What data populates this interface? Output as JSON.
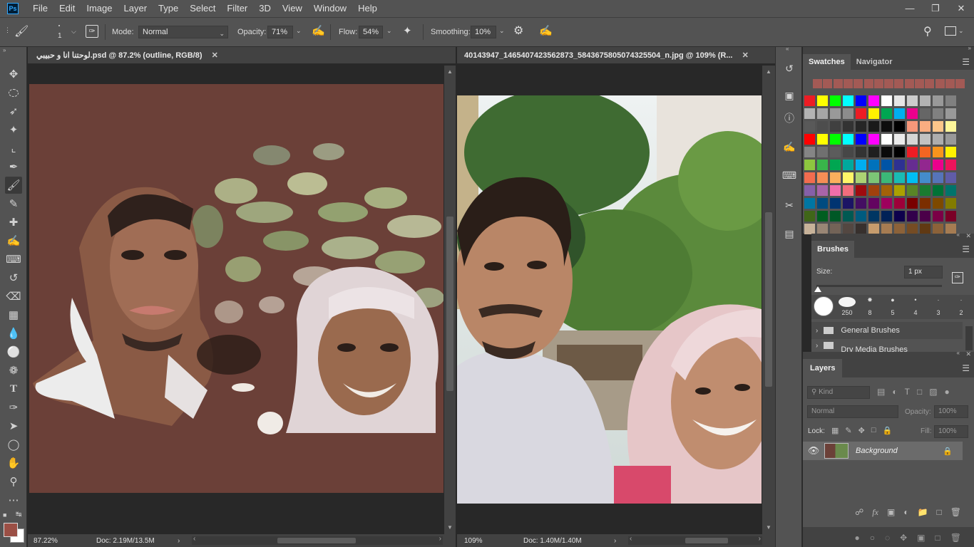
{
  "menu": {
    "app_icon": "Ps",
    "items": [
      "File",
      "Edit",
      "Image",
      "Layer",
      "Type",
      "Select",
      "Filter",
      "3D",
      "View",
      "Window",
      "Help"
    ],
    "window_controls": [
      "minimize-icon",
      "restore-icon",
      "close-icon"
    ]
  },
  "options": {
    "brush_size": "1",
    "mode_label": "Mode:",
    "mode_value": "Normal",
    "opacity_label": "Opacity:",
    "opacity_value": "71%",
    "flow_label": "Flow:",
    "flow_value": "54%",
    "smoothing_label": "Smoothing:",
    "smoothing_value": "10%"
  },
  "toolbar": {
    "tools": [
      "move-tool",
      "marquee-tool",
      "lasso-tool",
      "magic-wand-tool",
      "crop-tool",
      "eyedropper-tool",
      "brush-tool",
      "pencil-tool",
      "healing-tool",
      "clone-stamp-tool",
      "history-brush-tool",
      "eraser-tool",
      "paint-bucket-tool",
      "blur-tool",
      "dodge-tool",
      "sponge-tool",
      "type-tool",
      "pen-tool",
      "path-selection-tool",
      "ellipse-tool",
      "hand-tool",
      "zoom-tool",
      "more-tools"
    ],
    "foreground_color": "#9b4f45",
    "background_color": "#ffffff"
  },
  "doc1": {
    "tab_title": "لوحتنا انا و حبيبي.psd @ 87.2% (outline, RGB/8)",
    "zoom": "87.22%",
    "doc_size": "Doc: 2.19M/13.5M",
    "canvas_color": "#6b4038"
  },
  "doc2": {
    "tab_title": "40143947_1465407423562873_5843675805074325504_n.jpg @ 109% (R...",
    "zoom": "109%",
    "doc_size": "Doc: 1.40M/1.40M"
  },
  "swatches": {
    "tab_active": "Swatches",
    "tab_inactive": "Navigator",
    "recent": [
      "#a35a55",
      "#a35a55",
      "#a35a55",
      "#a35a55",
      "#a35a55",
      "#a35a55",
      "#a35a55",
      "#a35a55",
      "#a35a55",
      "#a35a55",
      "#a35a55",
      "#a35a55",
      "#a35a55",
      "#a35a55",
      "#a35a55"
    ],
    "grid": [
      [
        "#ff0000",
        "#ffff00",
        "#00ff00",
        "#00ffff",
        "#0000ff",
        "#ff00ff",
        "#ffffff",
        "#ebebeb",
        "#d6d6d6",
        "#c2c2c2",
        "#adadad",
        "#999999"
      ],
      [
        "#858585",
        "#707070",
        "#5c5c5c",
        "#474747",
        "#333333",
        "#1f1f1f",
        "#0a0a0a",
        "#000000",
        "#ed1c24",
        "#f26522",
        "#f7941d",
        "#fff200"
      ],
      [
        "#8dc63f",
        "#39b54a",
        "#00a651",
        "#00a99d",
        "#00aeef",
        "#0072bc",
        "#0054a6",
        "#2e3192",
        "#662d91",
        "#92278f",
        "#ec008c",
        "#ed145b"
      ],
      [
        "#f26c4f",
        "#f68e56",
        "#fbaf5d",
        "#fff568",
        "#acd373",
        "#7cc576",
        "#3bb878",
        "#1abbb4",
        "#00bff3",
        "#448ccb",
        "#5674b9",
        "#605ca8"
      ],
      [
        "#8560a8",
        "#a864a8",
        "#f06eaa",
        "#f26d7d",
        "#9e0b0f",
        "#a0410d",
        "#a36209",
        "#aba000",
        "#598527",
        "#1a7b30",
        "#007236",
        "#00746b"
      ],
      [
        "#0076a3",
        "#004b80",
        "#003471",
        "#1b1464",
        "#440e62",
        "#630460",
        "#9e005d",
        "#9e0039",
        "#790000",
        "#7b2e00",
        "#7d4900",
        "#827b00"
      ],
      [
        "#406618",
        "#005e20",
        "#005826",
        "#005952",
        "#005b7f",
        "#003663",
        "#002157",
        "#0d004c",
        "#32004b",
        "#4b0049",
        "#7b0046",
        "#7a0026"
      ],
      [
        "#c7b299",
        "#998675",
        "#736357",
        "#534741",
        "#37302d",
        "#c69c6d",
        "#a67c52",
        "#8c6239",
        "#754c24",
        "#603913",
        "#8c6239",
        "#a67c52"
      ]
    ],
    "grid_top_rows": [
      [
        "#ed1c24",
        "#ffff00",
        "#00ff00",
        "#00ffff",
        "#0000ff",
        "#ff00ff",
        "#ffffff",
        "#e6e6e6",
        "#cccccc",
        "#b3b3b3",
        "#999999",
        "#808080"
      ],
      [
        "#b3b3b3",
        "#a6a6a6",
        "#999999",
        "#8c8c8c",
        "#ed1c24",
        "#fff200",
        "#00a651",
        "#00aeef",
        "#ec008c",
        "#666666",
        "#808080",
        "#999999"
      ],
      [
        "#595959",
        "#4d4d4d",
        "#404040",
        "#333333",
        "#262626",
        "#1a1a1a",
        "#0d0d0d",
        "#000000",
        "#f7977a",
        "#f9ad81",
        "#fdc68a",
        "#fff79a"
      ]
    ]
  },
  "brushes": {
    "title": "Brushes",
    "size_label": "Size:",
    "size_value": "1 px",
    "tips": [
      "",
      "250",
      "8",
      "5",
      "4",
      "3",
      "2"
    ],
    "folder_label": "General Brushes",
    "folder2_label": "Dry Media Brushes"
  },
  "layers": {
    "title": "Layers",
    "filter_placeholder": "Kind",
    "blend_mode": "Normal",
    "opacity_label": "Opacity:",
    "opacity_value": "100%",
    "lock_label": "Lock:",
    "fill_label": "Fill:",
    "fill_value": "100%",
    "items": [
      {
        "name": "Background",
        "visible": true,
        "locked": true
      }
    ]
  }
}
